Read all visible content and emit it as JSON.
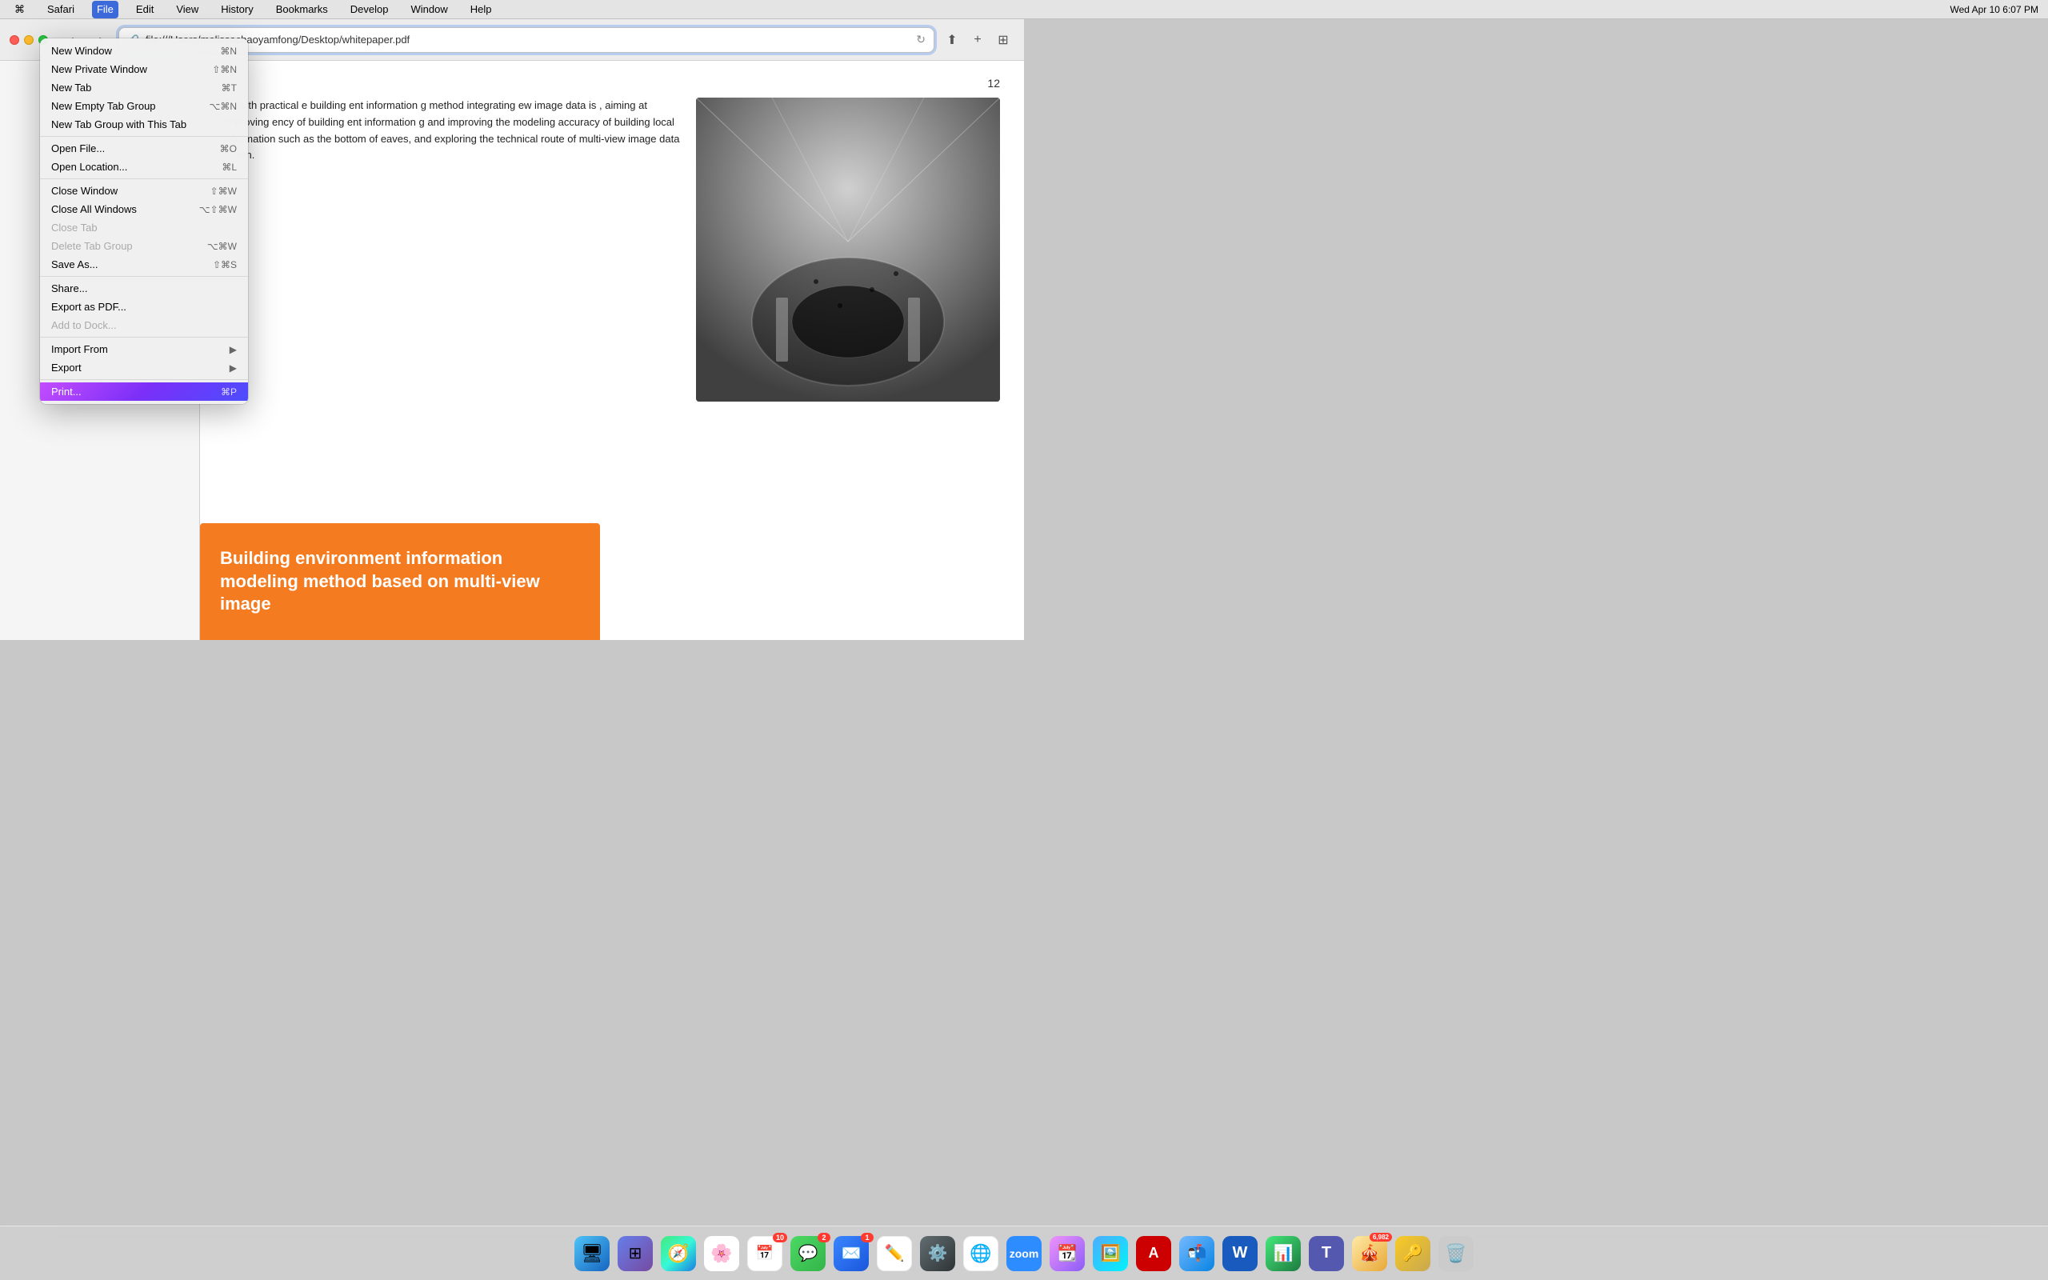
{
  "menubar": {
    "apple": "⌘",
    "items": [
      {
        "label": "Safari",
        "active": false
      },
      {
        "label": "File",
        "active": true
      },
      {
        "label": "Edit",
        "active": false
      },
      {
        "label": "View",
        "active": false
      },
      {
        "label": "History",
        "active": false
      },
      {
        "label": "Bookmarks",
        "active": false
      },
      {
        "label": "Develop",
        "active": false
      },
      {
        "label": "Window",
        "active": false
      },
      {
        "label": "Help",
        "active": false
      }
    ],
    "time": "Wed Apr 10  6:07 PM"
  },
  "toolbar": {
    "url": "file:///Users/melissachaoyamfong/Desktop/whitepaper.pdf"
  },
  "menu": {
    "items": [
      {
        "label": "New Window",
        "shortcut": "⌘N",
        "disabled": false,
        "separator_after": false,
        "has_submenu": false
      },
      {
        "label": "New Private Window",
        "shortcut": "⇧⌘N",
        "disabled": false,
        "separator_after": false,
        "has_submenu": false
      },
      {
        "label": "New Tab",
        "shortcut": "⌘T",
        "disabled": false,
        "separator_after": false,
        "has_submenu": false
      },
      {
        "label": "New Empty Tab Group",
        "shortcut": "⌥⌘N",
        "disabled": false,
        "separator_after": false,
        "has_submenu": false
      },
      {
        "label": "New Tab Group with This Tab",
        "shortcut": "",
        "disabled": false,
        "separator_after": true,
        "has_submenu": false
      },
      {
        "label": "Open File...",
        "shortcut": "⌘O",
        "disabled": false,
        "separator_after": false,
        "has_submenu": false
      },
      {
        "label": "Open Location...",
        "shortcut": "⌘L",
        "disabled": false,
        "separator_after": true,
        "has_submenu": false
      },
      {
        "label": "Close Window",
        "shortcut": "⇧⌘W",
        "disabled": false,
        "separator_after": false,
        "has_submenu": false
      },
      {
        "label": "Close All Windows",
        "shortcut": "⌥⇧⌘W",
        "disabled": false,
        "separator_after": false,
        "has_submenu": false
      },
      {
        "label": "Close Tab",
        "shortcut": "",
        "disabled": true,
        "separator_after": false,
        "has_submenu": false
      },
      {
        "label": "Delete Tab Group",
        "shortcut": "⌥⌘W",
        "disabled": true,
        "separator_after": false,
        "has_submenu": false
      },
      {
        "label": "Save As...",
        "shortcut": "⇧⌘S",
        "disabled": false,
        "separator_after": true,
        "has_submenu": false
      },
      {
        "label": "Share...",
        "shortcut": "",
        "disabled": false,
        "separator_after": false,
        "has_submenu": false
      },
      {
        "label": "Export as PDF...",
        "shortcut": "",
        "disabled": false,
        "separator_after": false,
        "has_submenu": false
      },
      {
        "label": "Add to Dock...",
        "shortcut": "",
        "disabled": true,
        "separator_after": true,
        "has_submenu": false
      },
      {
        "label": "Import From",
        "shortcut": "",
        "disabled": false,
        "separator_after": false,
        "has_submenu": true
      },
      {
        "label": "Export",
        "shortcut": "",
        "disabled": false,
        "separator_after": true,
        "has_submenu": true
      },
      {
        "label": "Print...",
        "shortcut": "⌘P",
        "disabled": false,
        "separator_after": false,
        "highlighted": true,
        "has_submenu": false
      }
    ]
  },
  "pdf": {
    "page_num": "12",
    "text_content": "ed with practical e building ent information g method integrating ew image data is , aiming at improving ency of building ent information g and improving the modeling accuracy of building local information such as the bottom of eaves, and exploring the technical route of multi-view image data fusion.",
    "orange_banner_text": "Building environment information modeling method based on multi-view image"
  },
  "dock": {
    "items": [
      {
        "label": "Finder",
        "color": "#1a7de3",
        "emoji": "🔵"
      },
      {
        "label": "Launchpad",
        "color": "#f5a623",
        "emoji": "🟠"
      },
      {
        "label": "Safari",
        "color": "#1a7de3",
        "emoji": "🧭"
      },
      {
        "label": "Photos",
        "color": "#f5a623",
        "emoji": "📷"
      },
      {
        "label": "Calendar",
        "color": "#f44",
        "emoji": "📅",
        "badge": "10"
      },
      {
        "label": "Messages",
        "color": "#4cd964",
        "emoji": "💬",
        "badge": "2"
      },
      {
        "label": "Mail",
        "color": "#3a86ff",
        "emoji": "✉️",
        "badge": "1"
      },
      {
        "label": "Freeform",
        "color": "#fff",
        "emoji": "✏️"
      },
      {
        "label": "System Settings",
        "color": "#888",
        "emoji": "⚙️"
      },
      {
        "label": "Chrome",
        "color": "#f44",
        "emoji": "🌐"
      },
      {
        "label": "Zoom",
        "color": "#2d8cff",
        "emoji": "📹"
      },
      {
        "label": "Fantastical",
        "color": "#8b5cf6",
        "emoji": "📆"
      },
      {
        "label": "Preview",
        "color": "#2a9d8f",
        "emoji": "🖼️"
      },
      {
        "label": "Acrobat",
        "color": "#f44",
        "emoji": "📄"
      },
      {
        "label": "Mail2",
        "color": "#3a86ff",
        "emoji": "📧"
      },
      {
        "label": "Word",
        "color": "#185abd",
        "emoji": "W"
      },
      {
        "label": "Numbers",
        "color": "#1d7a3e",
        "emoji": "📊"
      },
      {
        "label": "Teams",
        "color": "#5558af",
        "emoji": "T"
      },
      {
        "label": "Wunderbucket",
        "color": "#e8a838",
        "emoji": "🎪"
      },
      {
        "label": "Keychain",
        "color": "#c8a850",
        "emoji": "🔑"
      },
      {
        "label": "Trash",
        "color": "#888",
        "emoji": "🗑️",
        "badge": ""
      }
    ]
  }
}
